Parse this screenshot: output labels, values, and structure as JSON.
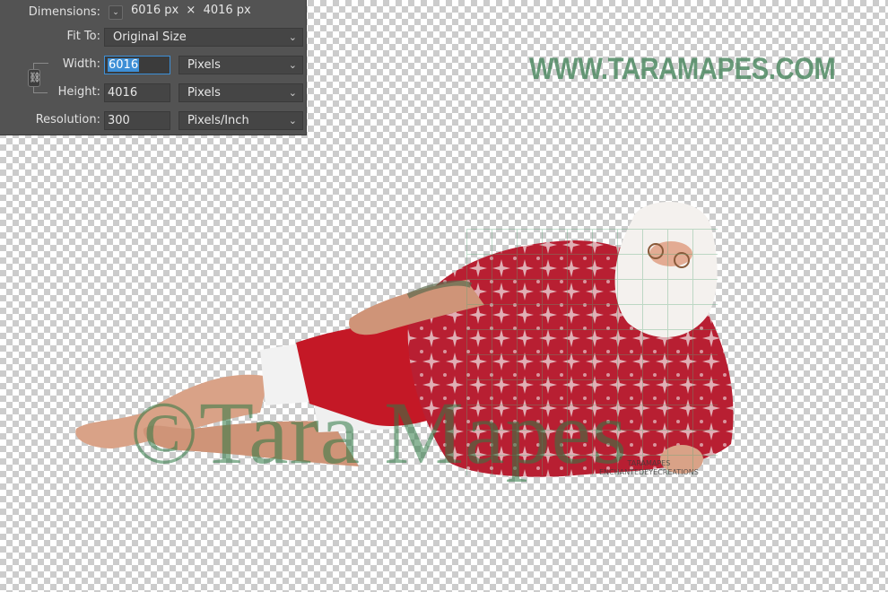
{
  "panel": {
    "dimensions_label": "Dimensions:",
    "dimensions_value": "6016 px  ×  4016 px",
    "fit_to_label": "Fit To:",
    "fit_to_value": "Original Size",
    "width_label": "Width:",
    "width_value": "6016",
    "width_unit": "Pixels",
    "height_label": "Height:",
    "height_value": "4016",
    "height_unit": "Pixels",
    "resolution_label": "Resolution:",
    "resolution_value": "300",
    "resolution_unit": "Pixels/Inch"
  },
  "watermarks": {
    "url": "WWW.TARAMAPES.COM",
    "big": "©Tara Mapes",
    "small_line1": "TARAMAPES",
    "small_line2": "ENCHANTEDEYECREATIONS"
  },
  "colors": {
    "panel_bg": "#535353",
    "focus_blue": "#3d8fd6",
    "watermark_green": "#4f8a63",
    "shirt_red": "#b81f32",
    "shorts_red": "#c41826"
  }
}
